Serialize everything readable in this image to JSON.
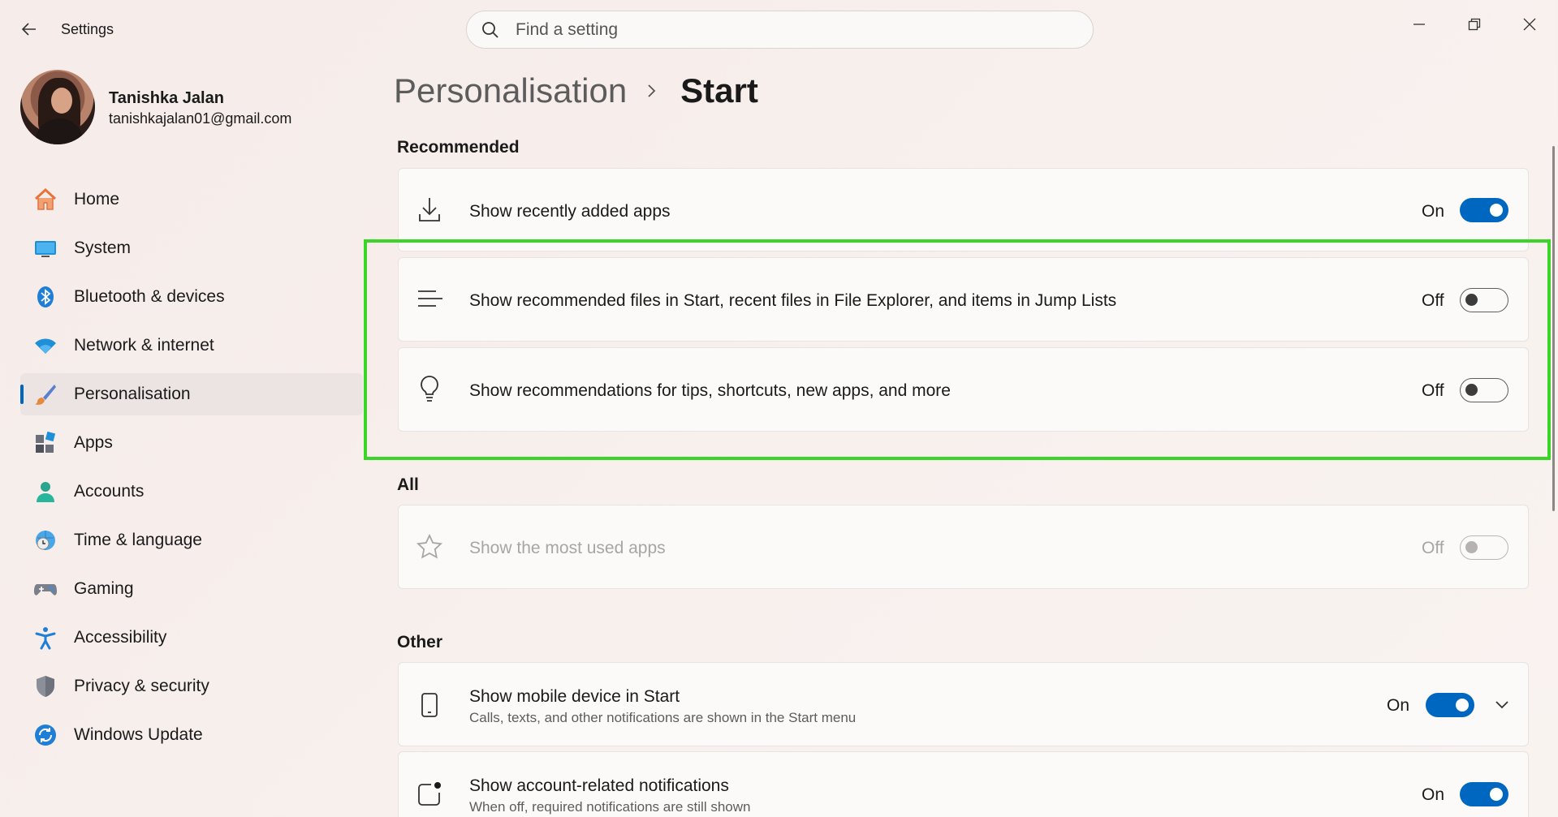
{
  "window": {
    "title": "Settings",
    "search_placeholder": "Find a setting"
  },
  "profile": {
    "name": "Tanishka Jalan",
    "email": "tanishkajalan01@gmail.com"
  },
  "nav": [
    {
      "label": "Home",
      "icon": "home-icon"
    },
    {
      "label": "System",
      "icon": "system-icon"
    },
    {
      "label": "Bluetooth & devices",
      "icon": "bluetooth-icon"
    },
    {
      "label": "Network & internet",
      "icon": "wifi-icon"
    },
    {
      "label": "Personalisation",
      "icon": "brush-icon",
      "active": true
    },
    {
      "label": "Apps",
      "icon": "apps-icon"
    },
    {
      "label": "Accounts",
      "icon": "account-icon"
    },
    {
      "label": "Time & language",
      "icon": "globe-clock-icon"
    },
    {
      "label": "Gaming",
      "icon": "gamepad-icon"
    },
    {
      "label": "Accessibility",
      "icon": "accessibility-icon"
    },
    {
      "label": "Privacy & security",
      "icon": "shield-icon"
    },
    {
      "label": "Windows Update",
      "icon": "update-icon"
    }
  ],
  "breadcrumb": {
    "parent": "Personalisation",
    "current": "Start"
  },
  "sections": {
    "recommended": "Recommended",
    "all": "All",
    "other": "Other"
  },
  "settings": {
    "recent_apps": {
      "label": "Show recently added apps",
      "state": "On"
    },
    "recommended_files": {
      "label": "Show recommended files in Start, recent files in File Explorer, and items in Jump Lists",
      "state": "Off"
    },
    "recommendations_tips": {
      "label": "Show recommendations for tips, shortcuts, new apps, and more",
      "state": "Off"
    },
    "most_used": {
      "label": "Show the most used apps",
      "state": "Off"
    },
    "mobile_device": {
      "label": "Show mobile device in Start",
      "sub": "Calls, texts, and other notifications are shown in the Start menu",
      "state": "On"
    },
    "account_notifications": {
      "label": "Show account-related notifications",
      "sub": "When off, required notifications are still shown",
      "state": "On"
    }
  },
  "colors": {
    "accent": "#0067c0",
    "highlight": "#3bd52a"
  }
}
